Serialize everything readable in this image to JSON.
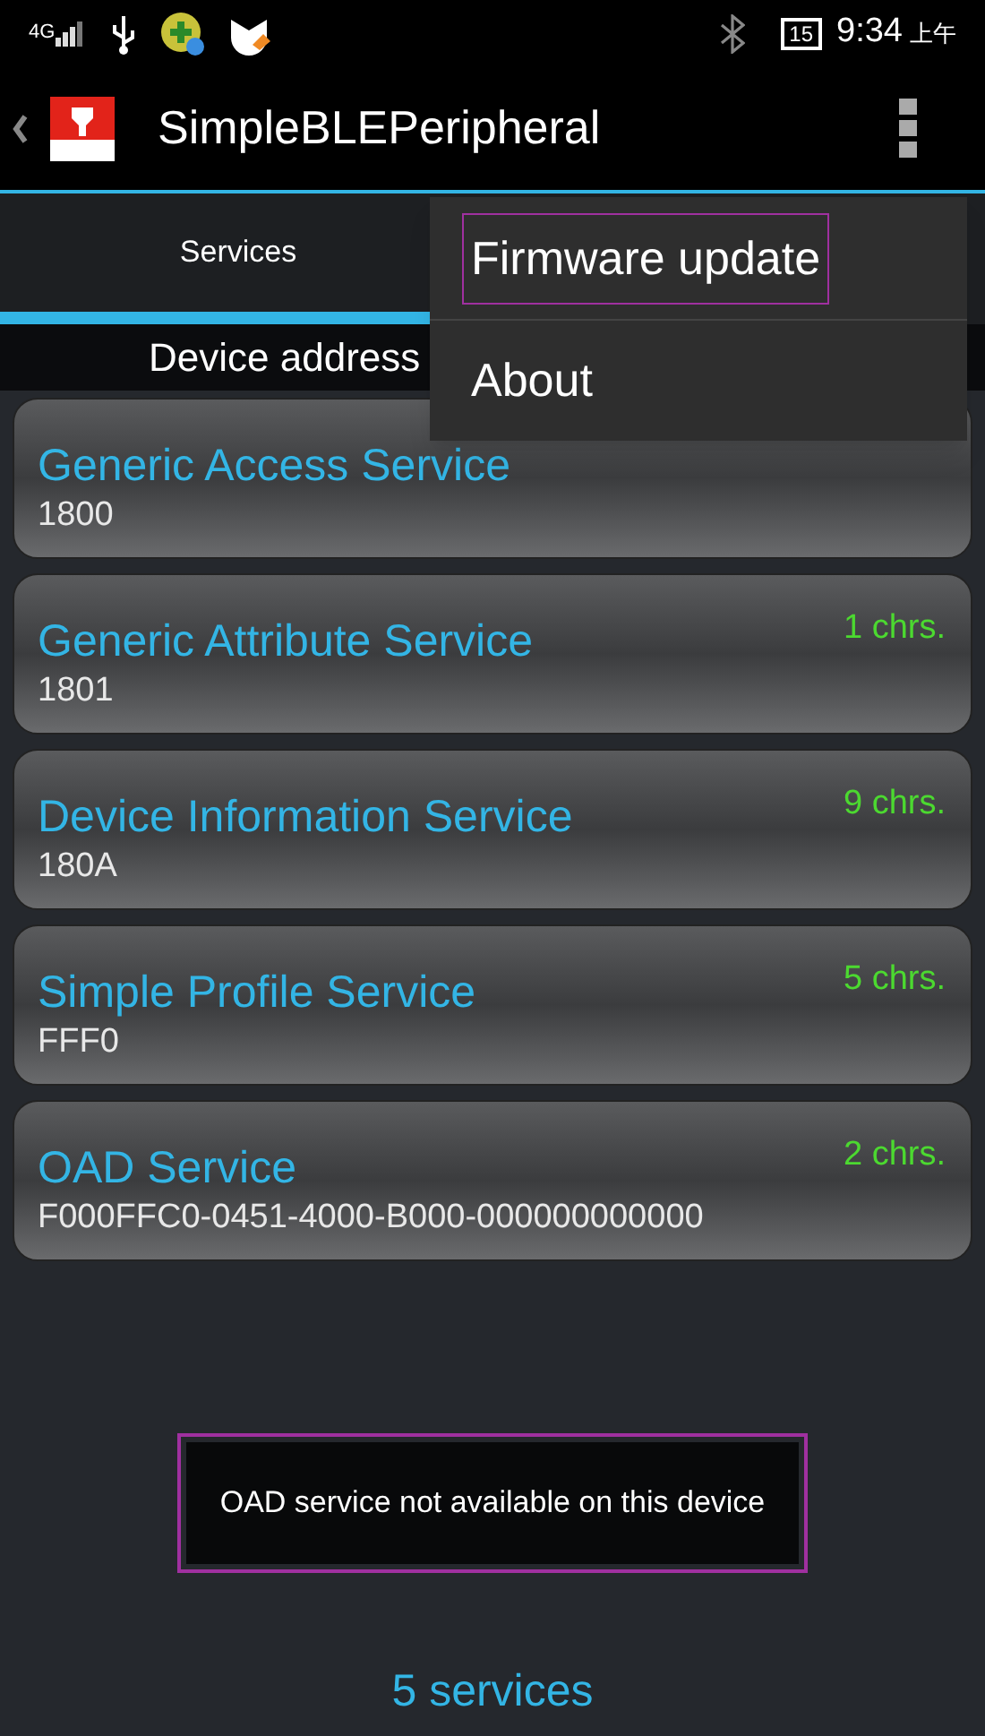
{
  "status_bar": {
    "network": "4G",
    "battery": "15",
    "time": "9:34",
    "am_pm": "上午"
  },
  "action_bar": {
    "title": "SimpleBLEPeripheral"
  },
  "tabs": [
    {
      "label": "Services",
      "selected": true
    }
  ],
  "device_address": "Device address",
  "services": [
    {
      "name": "Generic Access Service",
      "uuid": "1800"
    },
    {
      "name": "Generic Attribute Service",
      "uuid": "1801",
      "chrs": "1 chrs."
    },
    {
      "name": "Device Information Service",
      "uuid": "180A",
      "chrs": "9 chrs."
    },
    {
      "name": "Simple Profile Service",
      "uuid": "FFF0",
      "chrs": "5 chrs."
    },
    {
      "name": "OAD Service",
      "uuid": "F000FFC0-0451-4000-B000-000000000000",
      "chrs": "2 chrs."
    }
  ],
  "menu": [
    {
      "label": "Firmware update",
      "highlighted": true
    },
    {
      "label": "About",
      "highlighted": false
    }
  ],
  "toast": {
    "text": "OAD service not available on this device",
    "highlighted": true
  },
  "footer": "5 services"
}
